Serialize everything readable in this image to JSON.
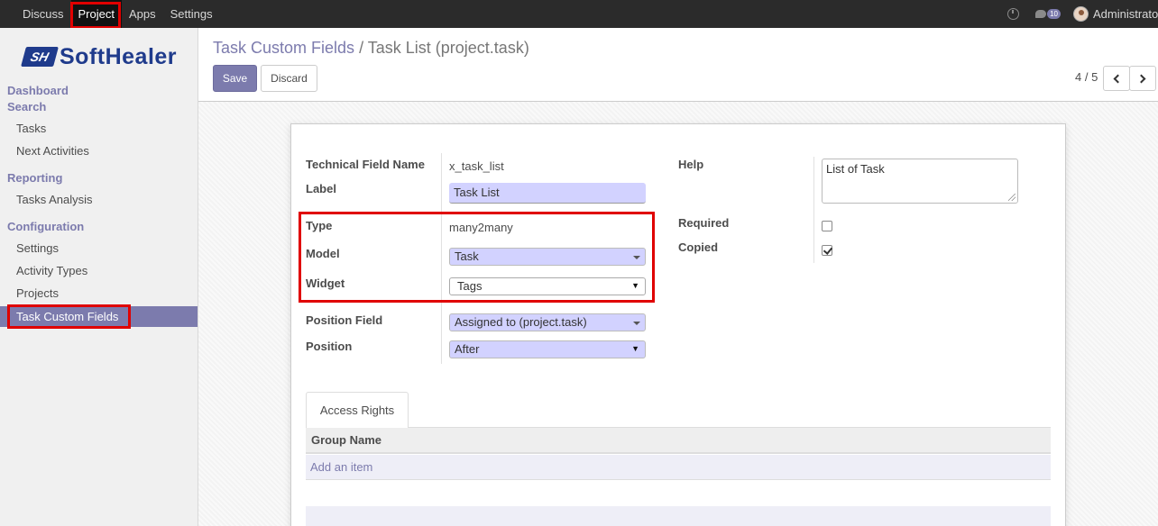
{
  "topbar": {
    "menu": [
      "Discuss",
      "Project",
      "Apps",
      "Settings"
    ],
    "active_menu": "Project",
    "chat_count": "10",
    "user_name": "Administrator"
  },
  "sidebar": {
    "logo_mark": "SH",
    "logo_text": "SoftHealer",
    "dashboard": "Dashboard",
    "search": "Search",
    "tasks": "Tasks",
    "next_activities": "Next Activities",
    "reporting": "Reporting",
    "tasks_analysis": "Tasks Analysis",
    "configuration": "Configuration",
    "settings": "Settings",
    "activity_types": "Activity Types",
    "projects": "Projects",
    "task_custom_fields": "Task Custom Fields"
  },
  "control": {
    "breadcrumb_parent": "Task Custom Fields",
    "breadcrumb_sep": "/",
    "breadcrumb_current": "Task List (project.task)",
    "save_label": "Save",
    "discard_label": "Discard",
    "pager": "4 / 5"
  },
  "form": {
    "technical_field_name_label": "Technical Field Name",
    "technical_field_name_value": "x_task_list",
    "label_label": "Label",
    "label_value": "Task List",
    "type_label": "Type",
    "type_value": "many2many",
    "model_label": "Model",
    "model_value": "Task",
    "widget_label": "Widget",
    "widget_value": "Tags",
    "position_field_label": "Position Field",
    "position_field_value": "Assigned to (project.task)",
    "position_label": "Position",
    "position_value": "After",
    "help_label": "Help",
    "help_value": "List of Task",
    "required_label": "Required",
    "required_checked": false,
    "copied_label": "Copied",
    "copied_checked": true
  },
  "notebook": {
    "tab_label": "Access Rights",
    "column_group_name": "Group Name",
    "add_item": "Add an item"
  },
  "colors": {
    "brand": "#7c7bad",
    "highlight": "#e00000",
    "required_field_bg": "#d2d2ff"
  }
}
